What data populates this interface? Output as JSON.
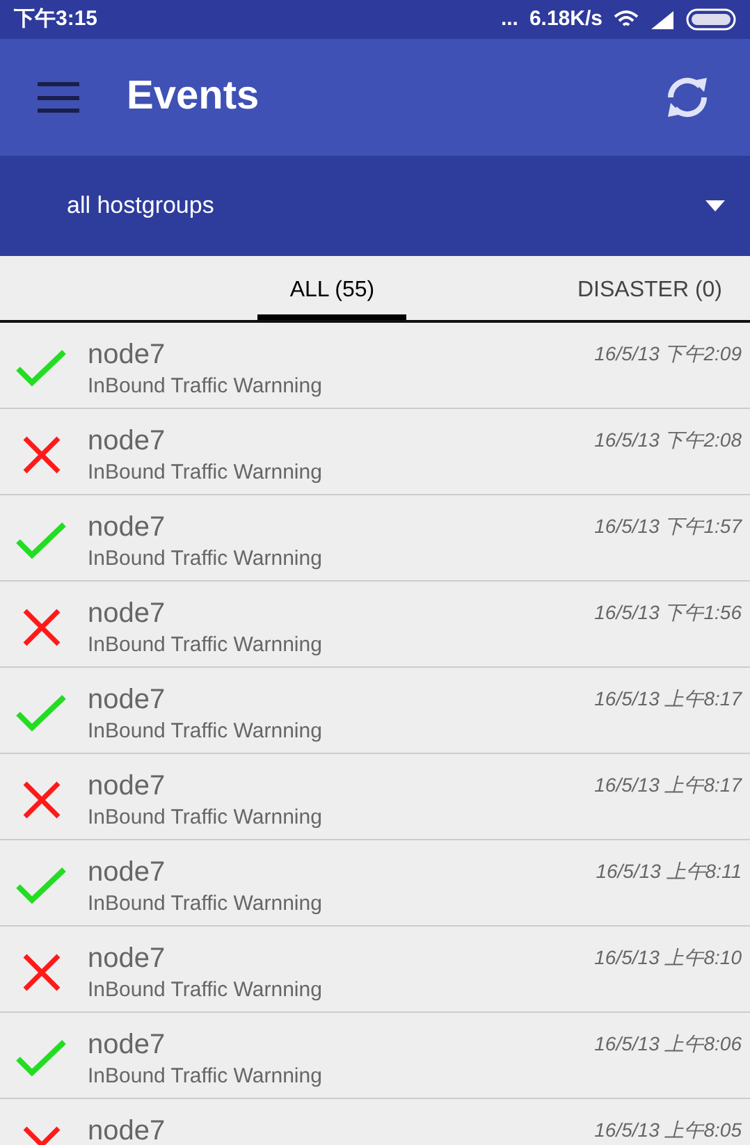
{
  "status_bar": {
    "time": "下午3:15",
    "more": "...",
    "speed": "6.18K/s"
  },
  "toolbar": {
    "title": "Events"
  },
  "filter": {
    "value": "all hostgroups"
  },
  "tabs": [
    {
      "label": "ALL (55)",
      "selected": true
    },
    {
      "label": "DISASTER (0)",
      "selected": false
    }
  ],
  "events": [
    {
      "kind": "ok",
      "host": "node7",
      "description": "InBound Traffic Warnning",
      "time": "16/5/13 下午2:09"
    },
    {
      "kind": "problem",
      "host": "node7",
      "description": "InBound Traffic Warnning",
      "time": "16/5/13 下午2:08"
    },
    {
      "kind": "ok",
      "host": "node7",
      "description": "InBound Traffic Warnning",
      "time": "16/5/13 下午1:57"
    },
    {
      "kind": "problem",
      "host": "node7",
      "description": "InBound Traffic Warnning",
      "time": "16/5/13 下午1:56"
    },
    {
      "kind": "ok",
      "host": "node7",
      "description": "InBound Traffic Warnning",
      "time": "16/5/13 上午8:17"
    },
    {
      "kind": "problem",
      "host": "node7",
      "description": "InBound Traffic Warnning",
      "time": "16/5/13 上午8:17"
    },
    {
      "kind": "ok",
      "host": "node7",
      "description": "InBound Traffic Warnning",
      "time": "16/5/13 上午8:11"
    },
    {
      "kind": "problem",
      "host": "node7",
      "description": "InBound Traffic Warnning",
      "time": "16/5/13 上午8:10"
    },
    {
      "kind": "ok",
      "host": "node7",
      "description": "InBound Traffic Warnning",
      "time": "16/5/13 上午8:06"
    },
    {
      "kind": "problem",
      "host": "node7",
      "time": "16/5/13 上午8:05"
    }
  ]
}
